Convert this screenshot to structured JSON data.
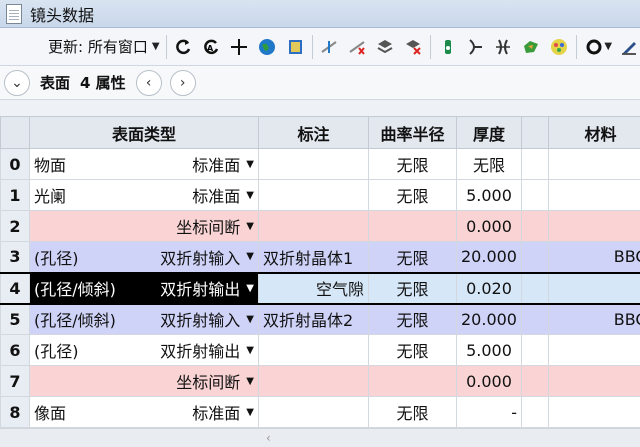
{
  "window": {
    "title": "镜头数据"
  },
  "toolbar": {
    "update_label": "更新: 所有窗口",
    "icons": [
      "refresh-icon",
      "auto-update-icon",
      "crosshair-icon",
      "globe-icon",
      "book-icon",
      "slider-icon",
      "slider-x-icon",
      "lens-icon",
      "lens-x-icon",
      "bottle-icon",
      "wire-icon",
      "prism-icon",
      "map-icon",
      "palette-icon",
      "ring-icon",
      "pen-icon"
    ]
  },
  "subbar": {
    "label_surface": "表面",
    "label_props": "4 属性"
  },
  "table": {
    "headers": {
      "type": "表面类型",
      "note": "标注",
      "curvature": "曲率半径",
      "thickness": "厚度",
      "material": "材料"
    },
    "rows": [
      {
        "num": "0",
        "prefix": "物面",
        "type": "标准面",
        "note": "",
        "curvature": "无限",
        "thickness": "无限",
        "material": ""
      },
      {
        "num": "1",
        "prefix": "光阑",
        "type": "标准面",
        "note": "",
        "curvature": "无限",
        "thickness": "5.000",
        "material": ""
      },
      {
        "num": "2",
        "prefix": "",
        "type": "坐标间断",
        "note": "",
        "curvature": "",
        "thickness": "0.000",
        "material": "-"
      },
      {
        "num": "3",
        "prefix": "(孔径)",
        "type": "双折射输入",
        "note": "双折射晶体1",
        "curvature": "无限",
        "thickness": "20.000",
        "material": "BBO"
      },
      {
        "num": "4",
        "prefix": "(孔径/倾斜)",
        "type": "双折射输出",
        "note": "空气隙",
        "curvature": "无限",
        "thickness": "0.020",
        "material": ""
      },
      {
        "num": "5",
        "prefix": "(孔径/倾斜)",
        "type": "双折射输入",
        "note": "双折射晶体2",
        "curvature": "无限",
        "thickness": "20.000",
        "material": "BBO"
      },
      {
        "num": "6",
        "prefix": "(孔径)",
        "type": "双折射输出",
        "note": "",
        "curvature": "无限",
        "thickness": "5.000",
        "material": ""
      },
      {
        "num": "7",
        "prefix": "",
        "type": "坐标间断",
        "note": "",
        "curvature": "",
        "thickness": "0.000",
        "material": "-"
      },
      {
        "num": "8",
        "prefix": "像面",
        "type": "标准面",
        "note": "",
        "curvature": "无限",
        "thickness": "-",
        "material": ""
      }
    ]
  },
  "colors": {
    "pink_row": "#fad4d4",
    "blue_row": "#cfd3f8",
    "selected_row": "#d6e8f8",
    "header": "#e3e8ef"
  }
}
